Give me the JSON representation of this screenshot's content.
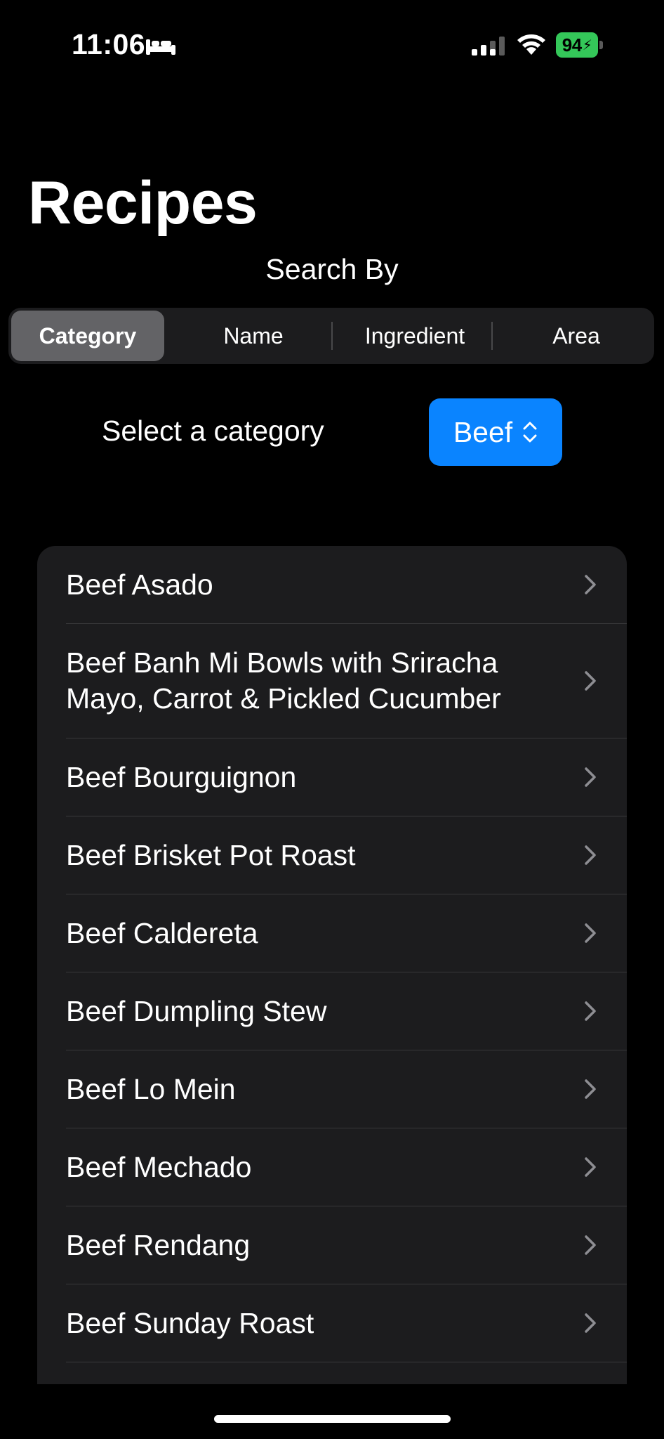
{
  "status_bar": {
    "time": "11:06",
    "battery": "94"
  },
  "header": {
    "title": "Recipes",
    "search_by_label": "Search By"
  },
  "segments": [
    {
      "label": "Category",
      "selected": true
    },
    {
      "label": "Name",
      "selected": false
    },
    {
      "label": "Ingredient",
      "selected": false
    },
    {
      "label": "Area",
      "selected": false
    }
  ],
  "category_picker": {
    "label": "Select a category",
    "value": "Beef"
  },
  "recipes": [
    {
      "name": "Beef Asado"
    },
    {
      "name": "Beef Banh Mi Bowls with Sriracha Mayo, Carrot & Pickled Cucumber"
    },
    {
      "name": "Beef Bourguignon"
    },
    {
      "name": "Beef Brisket Pot Roast"
    },
    {
      "name": "Beef Caldereta"
    },
    {
      "name": "Beef Dumpling Stew"
    },
    {
      "name": "Beef Lo Mein"
    },
    {
      "name": "Beef Mechado"
    },
    {
      "name": "Beef Rendang"
    },
    {
      "name": "Beef Sunday Roast"
    }
  ],
  "colors": {
    "accent": "#0a84ff",
    "battery": "#34c759",
    "list_background": "#1c1c1e",
    "selected_segment": "#636366"
  }
}
